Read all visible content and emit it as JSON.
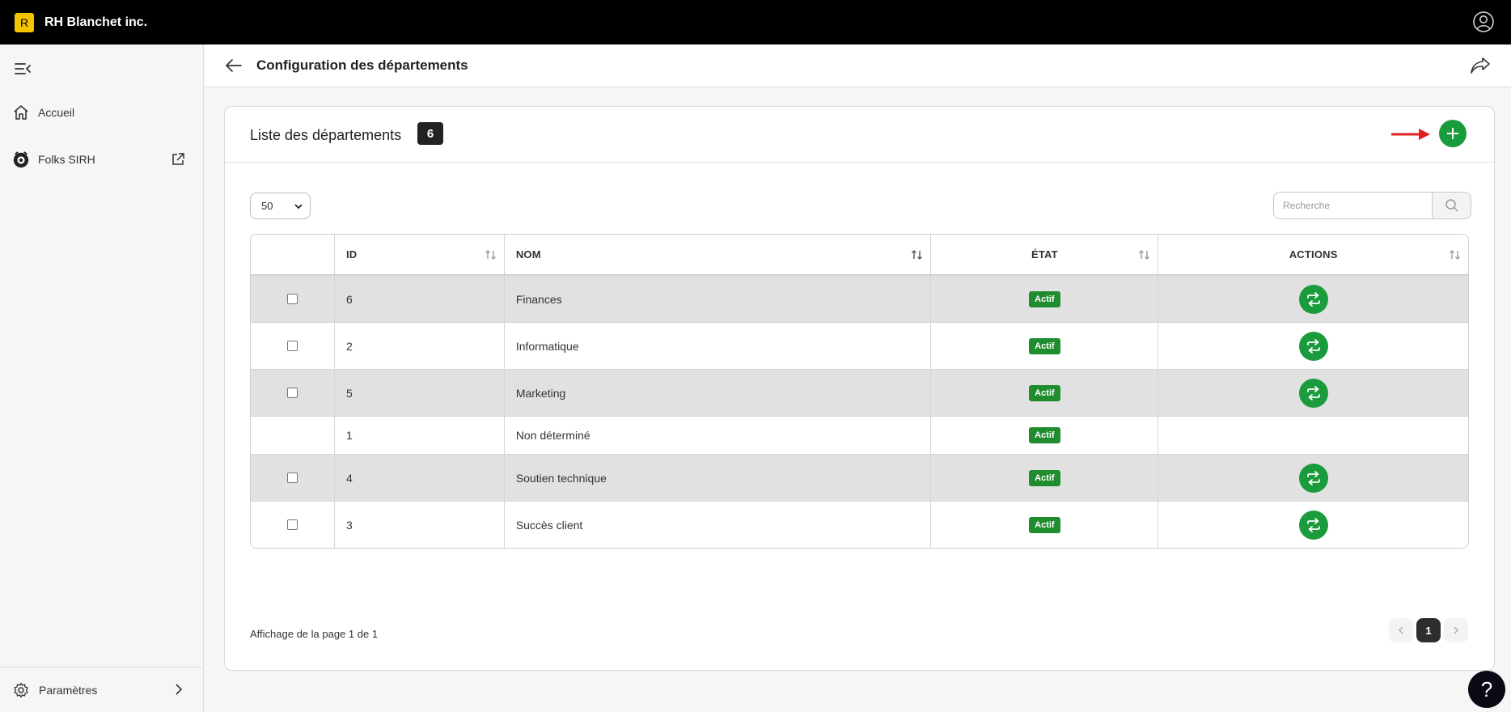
{
  "app": {
    "logo_letter": "R",
    "company_name": "RH Blanchet inc."
  },
  "sidebar": {
    "items": [
      {
        "label": "Accueil",
        "icon": "home-icon"
      },
      {
        "label": "Folks SIRH",
        "icon": "folks-logo-icon"
      }
    ],
    "bottom": {
      "label": "Paramètres",
      "icon": "gear-icon"
    }
  },
  "header": {
    "title": "Configuration des départements"
  },
  "card": {
    "title": "Liste des départements",
    "count": "6",
    "page_size": "50",
    "search_placeholder": "Recherche"
  },
  "table": {
    "columns": [
      "ID",
      "NOM",
      "ÉTAT",
      "ACTIONS"
    ],
    "rows": [
      {
        "id": "6",
        "name": "Finances",
        "state": "Actif",
        "checkbox": true,
        "action": true
      },
      {
        "id": "2",
        "name": "Informatique",
        "state": "Actif",
        "checkbox": true,
        "action": true
      },
      {
        "id": "5",
        "name": "Marketing",
        "state": "Actif",
        "checkbox": true,
        "action": true
      },
      {
        "id": "1",
        "name": "Non déterminé",
        "state": "Actif",
        "checkbox": false,
        "action": false
      },
      {
        "id": "4",
        "name": "Soutien technique",
        "state": "Actif",
        "checkbox": true,
        "action": true
      },
      {
        "id": "3",
        "name": "Succès client",
        "state": "Actif",
        "checkbox": true,
        "action": true
      }
    ]
  },
  "footer": {
    "page_info": "Affichage de la page 1 de 1",
    "current_page": "1"
  },
  "help": {
    "label": "?"
  },
  "colors": {
    "accent_green": "#1a9b3c",
    "badge_green": "#1f8d2e",
    "logo_yellow": "#f5c400",
    "arrow_red": "#e02020"
  }
}
